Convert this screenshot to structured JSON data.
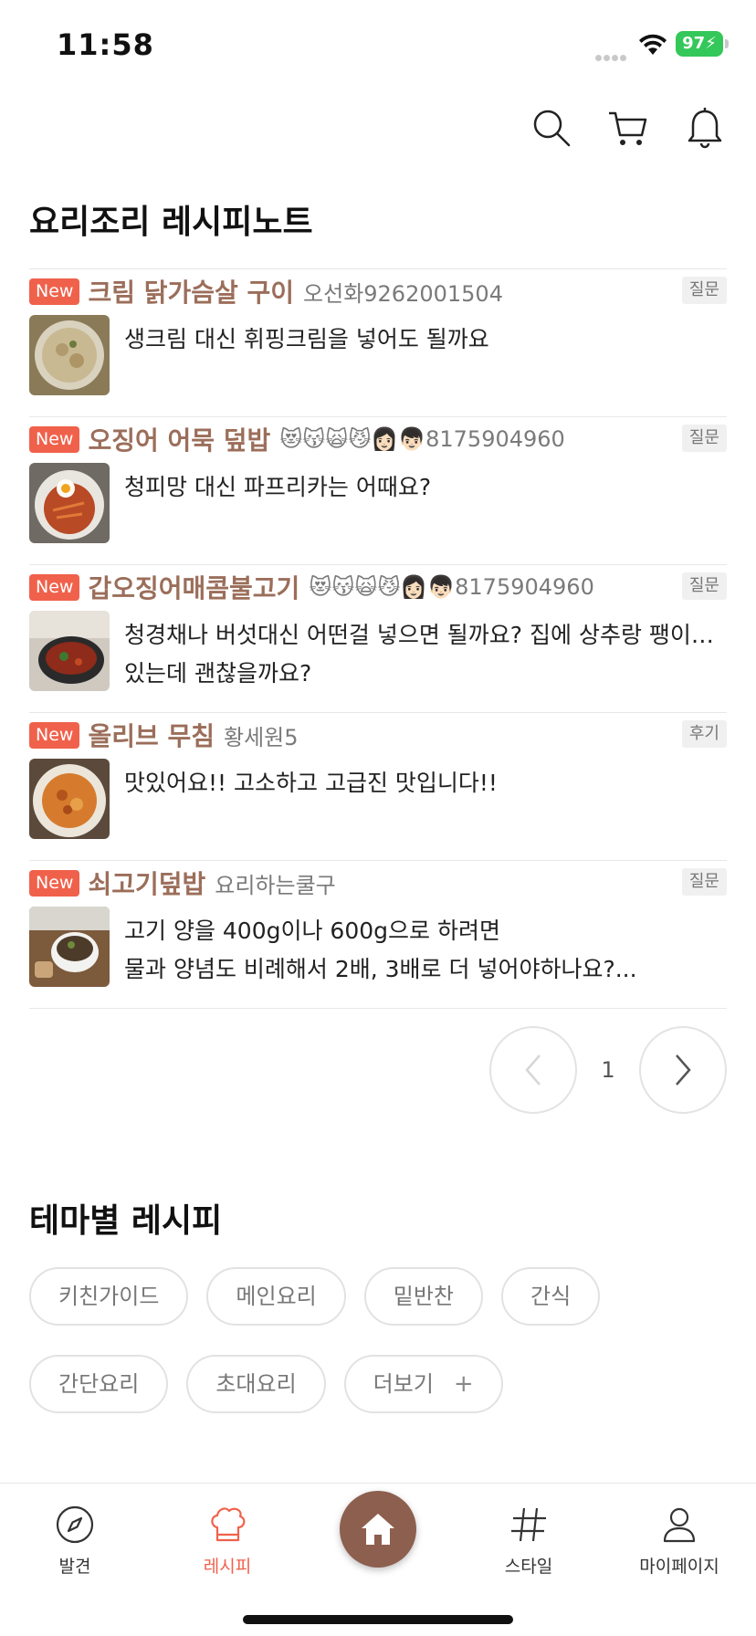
{
  "status_bar": {
    "time": "11:58",
    "battery": "97"
  },
  "header": {
    "icons": [
      "search-icon",
      "cart-icon",
      "bell-icon"
    ]
  },
  "notes_section": {
    "title": "요리조리 레시피노트",
    "items": [
      {
        "badge": "New",
        "title": "크림 닭가슴살 구이",
        "author": "오선화9262001504",
        "tag": "질문",
        "body": [
          "생크림 대신 휘핑크림을 넣어도 될까요"
        ]
      },
      {
        "badge": "New",
        "title": "오징어 어묵 덮밥",
        "author": "😻😽🙀😼👩🏻👦🏻8175904960",
        "tag": "질문",
        "body": [
          "청피망 대신 파프리카는 어때요?"
        ]
      },
      {
        "badge": "New",
        "title": "갑오징어매콤불고기",
        "author": "😻😽🙀😼👩🏻👦🏻8175904960",
        "tag": "질문",
        "body": [
          "청경채나 버섯대신 어떤걸 넣으면 될까요? 집에 상추랑 팽이버섯",
          "있는데 괜찮을까요?"
        ]
      },
      {
        "badge": "New",
        "title": "올리브 무침",
        "author": "황세원5",
        "tag": "후기",
        "body": [
          "맛있어요!! 고소하고 고급진 맛입니다!!"
        ]
      },
      {
        "badge": "New",
        "title": "쇠고기덮밥",
        "author": "요리하는쿨구",
        "tag": "질문",
        "body": [
          "고기 양을 400g이나 600g으로 하려면",
          "물과 양념도 비례해서 2배, 3배로 더 넣어야하나요?..."
        ]
      }
    ],
    "pager": {
      "current_page": "1"
    }
  },
  "theme_section": {
    "title": "테마별 레시피",
    "chips_row1": [
      "키친가이드",
      "메인요리",
      "밑반찬",
      "간식"
    ],
    "chips_row2": [
      "간단요리",
      "초대요리",
      "더보기"
    ],
    "more_symbol": "+"
  },
  "bottom_nav": {
    "discover": "발견",
    "recipe": "레시피",
    "style": "스타일",
    "mypage": "마이페이지"
  },
  "colors": {
    "accent": "#f0614b",
    "brand_brown": "#9b6e5a",
    "home_button": "#8d5f4e",
    "battery": "#34c759"
  }
}
